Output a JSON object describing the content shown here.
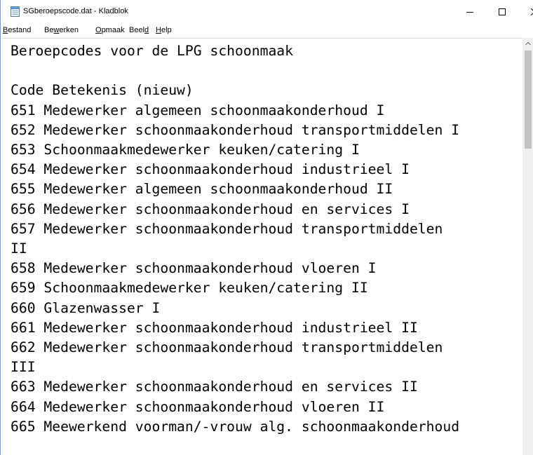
{
  "window": {
    "title": "SGberoepscode.dat - Kladblok",
    "icon": "notepad-icon"
  },
  "controls": {
    "minimize_icon": "minimize-icon",
    "maximize_icon": "maximize-icon",
    "close_icon": "close-icon"
  },
  "menu": {
    "bestand": {
      "ul": "B",
      "rest": "estand"
    },
    "bewerken": {
      "pre": "Be",
      "ul": "w",
      "rest": "erken"
    },
    "opmaak": {
      "ul": "O",
      "rest": "pmaak"
    },
    "beeld": {
      "pre": "Beel",
      "ul": "d"
    },
    "help": {
      "ul": "H",
      "rest": "elp"
    }
  },
  "document": {
    "lines": [
      "Beroepcodes voor de LPG schoonmaak",
      "",
      "Code Betekenis (nieuw)",
      "651 Medewerker algemeen schoonmaakonderhoud I",
      "652 Medewerker schoonmaakonderhoud transportmiddelen I",
      "653 Schoonmaakmedewerker keuken/catering I",
      "654 Medewerker schoonmaakonderhoud industrieel I",
      "655 Medewerker algemeen schoonmaakonderhoud II",
      "656 Medewerker schoonmaakonderhoud en services I",
      "657 Medewerker schoonmaakonderhoud transportmiddelen",
      "II",
      "658 Medewerker schoonmaakonderhoud vloeren I",
      "659 Schoonmaakmedewerker keuken/catering II",
      "660 Glazenwasser I",
      "661 Medewerker schoonmaakonderhoud industrieel II",
      "662 Medewerker schoonmaakonderhoud transportmiddelen",
      "III",
      "663 Medewerker schoonmaakonderhoud en services II",
      "664 Medewerker schoonmaakonderhoud vloeren II",
      "665 Meewerkend voorman/-vrouw alg. schoonmaakonderhoud"
    ]
  },
  "colors": {
    "frame_border": "#7a9cc6",
    "scrollbar_track": "#f0f0f0",
    "scrollbar_thumb": "#c2c2c2"
  }
}
